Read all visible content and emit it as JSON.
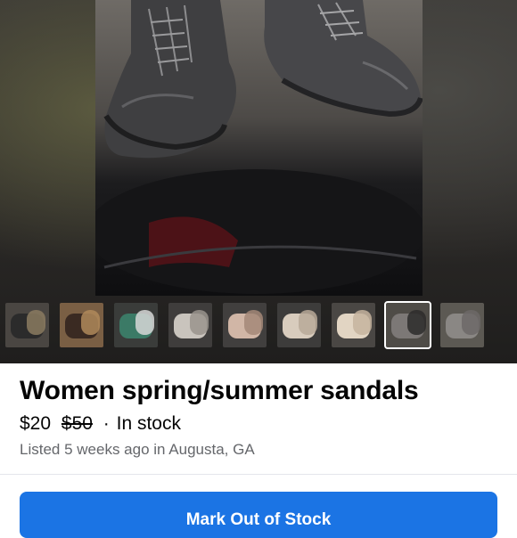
{
  "listing": {
    "title": "Women spring/summer sandals",
    "price": "$20",
    "original_price": "$50",
    "separator": "·",
    "availability": "In stock",
    "listed_info": "Listed 5 weeks ago in Augusta, GA"
  },
  "actions": {
    "primary_label": "Mark Out of Stock"
  },
  "gallery": {
    "selected_index": 7,
    "thumbnails": [
      {
        "bg": "#4a4642",
        "shoe": "#2b2b2b",
        "accent": "#8b7b60"
      },
      {
        "bg": "#7a5f44",
        "shoe": "#3a2a22",
        "accent": "#b08a5b"
      },
      {
        "bg": "#3a3c3a",
        "shoe": "#3b7a66",
        "accent": "#d7d7d7"
      },
      {
        "bg": "#3f3d3c",
        "shoe": "#c9c4bd",
        "accent": "#9a948d"
      },
      {
        "bg": "#413f3e",
        "shoe": "#d1b6a6",
        "accent": "#a58878"
      },
      {
        "bg": "#3d3c3b",
        "shoe": "#d8ccbd",
        "accent": "#b8a999"
      },
      {
        "bg": "#4a4744",
        "shoe": "#e2d5c3",
        "accent": "#c5b49f"
      },
      {
        "bg": "#4f4c47",
        "shoe": "#7c7876",
        "accent": "#2d2c2c"
      },
      {
        "bg": "#5c5953",
        "shoe": "#8a8784",
        "accent": "#6c6967"
      }
    ]
  }
}
